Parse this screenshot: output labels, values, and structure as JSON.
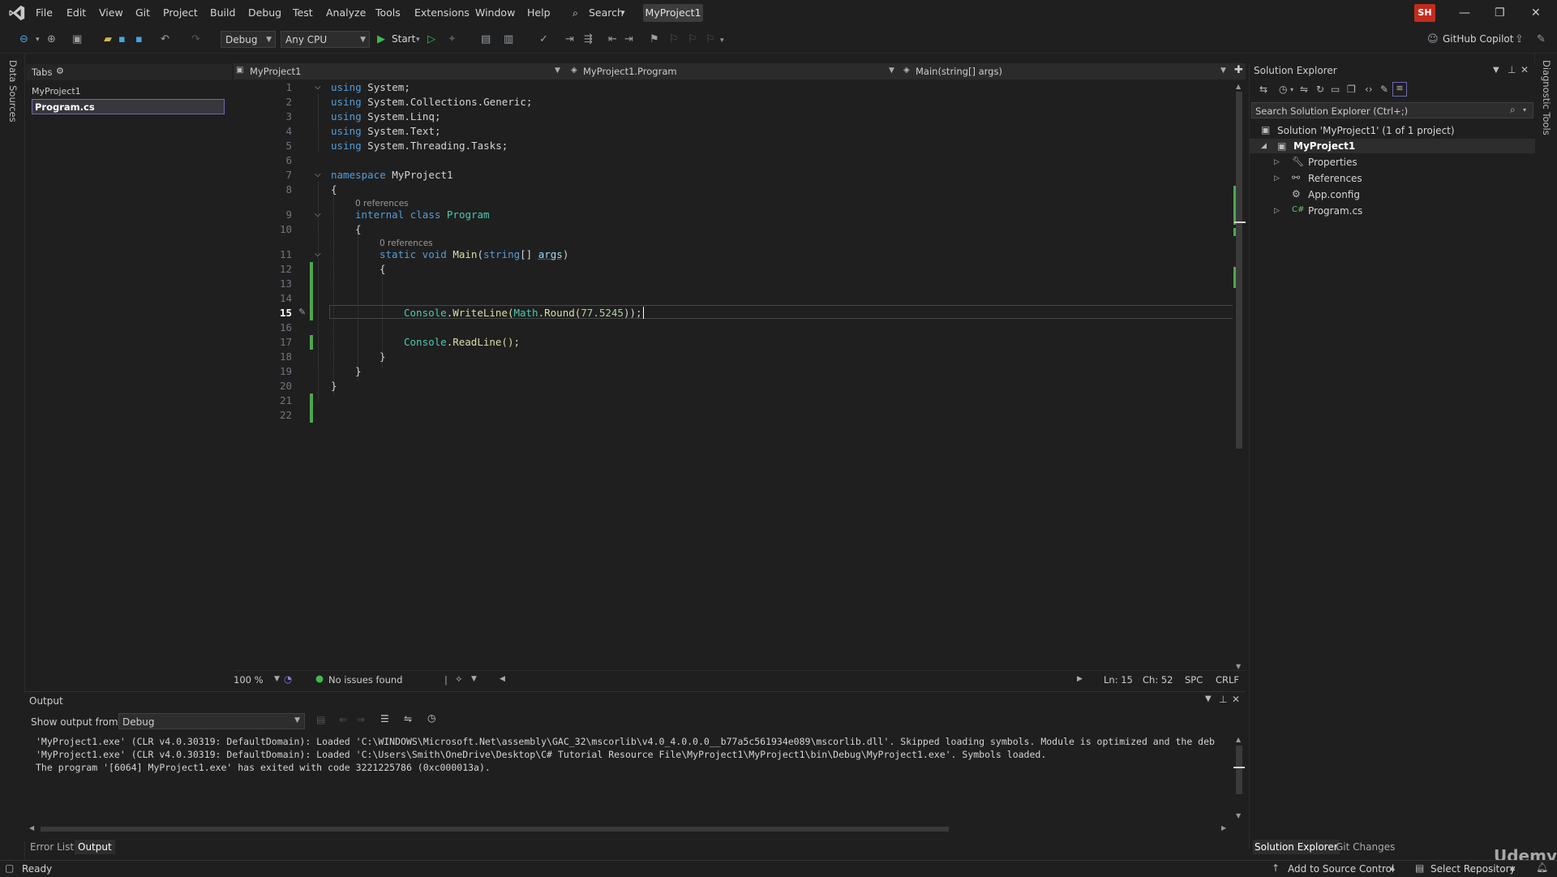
{
  "menu": {
    "items": [
      "File",
      "Edit",
      "View",
      "Git",
      "Project",
      "Build",
      "Debug",
      "Test",
      "Analyze",
      "Tools",
      "Extensions",
      "Window",
      "Help"
    ],
    "search_label": "Search",
    "project_title": "MyProject1",
    "user_initials": "SH"
  },
  "toolbar": {
    "config": "Debug",
    "platform": "Any CPU",
    "start_label": "Start",
    "copilot_label": "GitHub Copilot"
  },
  "side_labels": {
    "left": "Data Sources",
    "right": "Diagnostic Tools"
  },
  "tabs_panel": {
    "title": "Tabs",
    "project": "MyProject1",
    "file": "Program.cs"
  },
  "nav_bar": {
    "project": "MyProject1",
    "class": "MyProject1.Program",
    "member": "Main(string[] args)"
  },
  "editor": {
    "line_numbers": [
      "1",
      "2",
      "3",
      "4",
      "5",
      "6",
      "7",
      "8",
      "9",
      "10",
      "11",
      "12",
      "13",
      "14",
      "15",
      "16",
      "17",
      "18",
      "19",
      "20",
      "21",
      "22"
    ],
    "refs_class": "0 references",
    "refs_main": "0 references",
    "using_kw": "using",
    "usings": [
      "System;",
      "System.Collections.Generic;",
      "System.Linq;",
      "System.Text;",
      "System.Threading.Tasks;"
    ],
    "namespace_kw": "namespace",
    "namespace_name": "MyProject1",
    "class_mods": "internal class",
    "class_name": "Program",
    "main_mods": "static void",
    "main_name": "Main",
    "main_param_type": "string",
    "main_param_rest": "[]",
    "main_param_name": "args",
    "open_brace": "{",
    "close_brace": "}",
    "line15_console": "Console",
    "line15_writeline": ".WriteLine(",
    "line15_math": "Math",
    "line15_round": ".Round(",
    "line15_number": "77.5245",
    "line15_end": "));",
    "line17_console": "Console",
    "line17_readline": ".ReadLine();"
  },
  "editor_status": {
    "zoom": "100 %",
    "issues": "No issues found",
    "line": "Ln: 15",
    "col": "Ch: 52",
    "spc": "SPC",
    "eol": "CRLF"
  },
  "output": {
    "title": "Output",
    "show_from_label": "Show output from:",
    "source": "Debug",
    "lines": [
      "'MyProject1.exe' (CLR v4.0.30319: DefaultDomain): Loaded 'C:\\WINDOWS\\Microsoft.Net\\assembly\\GAC_32\\mscorlib\\v4.0_4.0.0.0__b77a5c561934e089\\mscorlib.dll'. Skipped loading symbols. Module is optimized and the deb",
      "'MyProject1.exe' (CLR v4.0.30319: DefaultDomain): Loaded 'C:\\Users\\Smith\\OneDrive\\Desktop\\C# Tutorial Resource File\\MyProject1\\MyProject1\\bin\\Debug\\MyProject1.exe'. Symbols loaded.",
      "The program '[6064] MyProject1.exe' has exited with code 3221225786 (0xc000013a)."
    ]
  },
  "solution": {
    "title": "Solution Explorer",
    "search_placeholder": "Search Solution Explorer (Ctrl+;)",
    "solution_label": "Solution 'MyProject1' (1 of 1 project)",
    "project": "MyProject1",
    "items": [
      "Properties",
      "References",
      "App.config",
      "Program.cs"
    ]
  },
  "bottom_tabs": {
    "left": [
      "Error List",
      "Output"
    ],
    "right": [
      "Solution Explorer",
      "Git Changes"
    ]
  },
  "statusbar": {
    "ready": "Ready",
    "source_control": "Add to Source Control",
    "repository": "Select Repository"
  },
  "watermark": "Udemy"
}
